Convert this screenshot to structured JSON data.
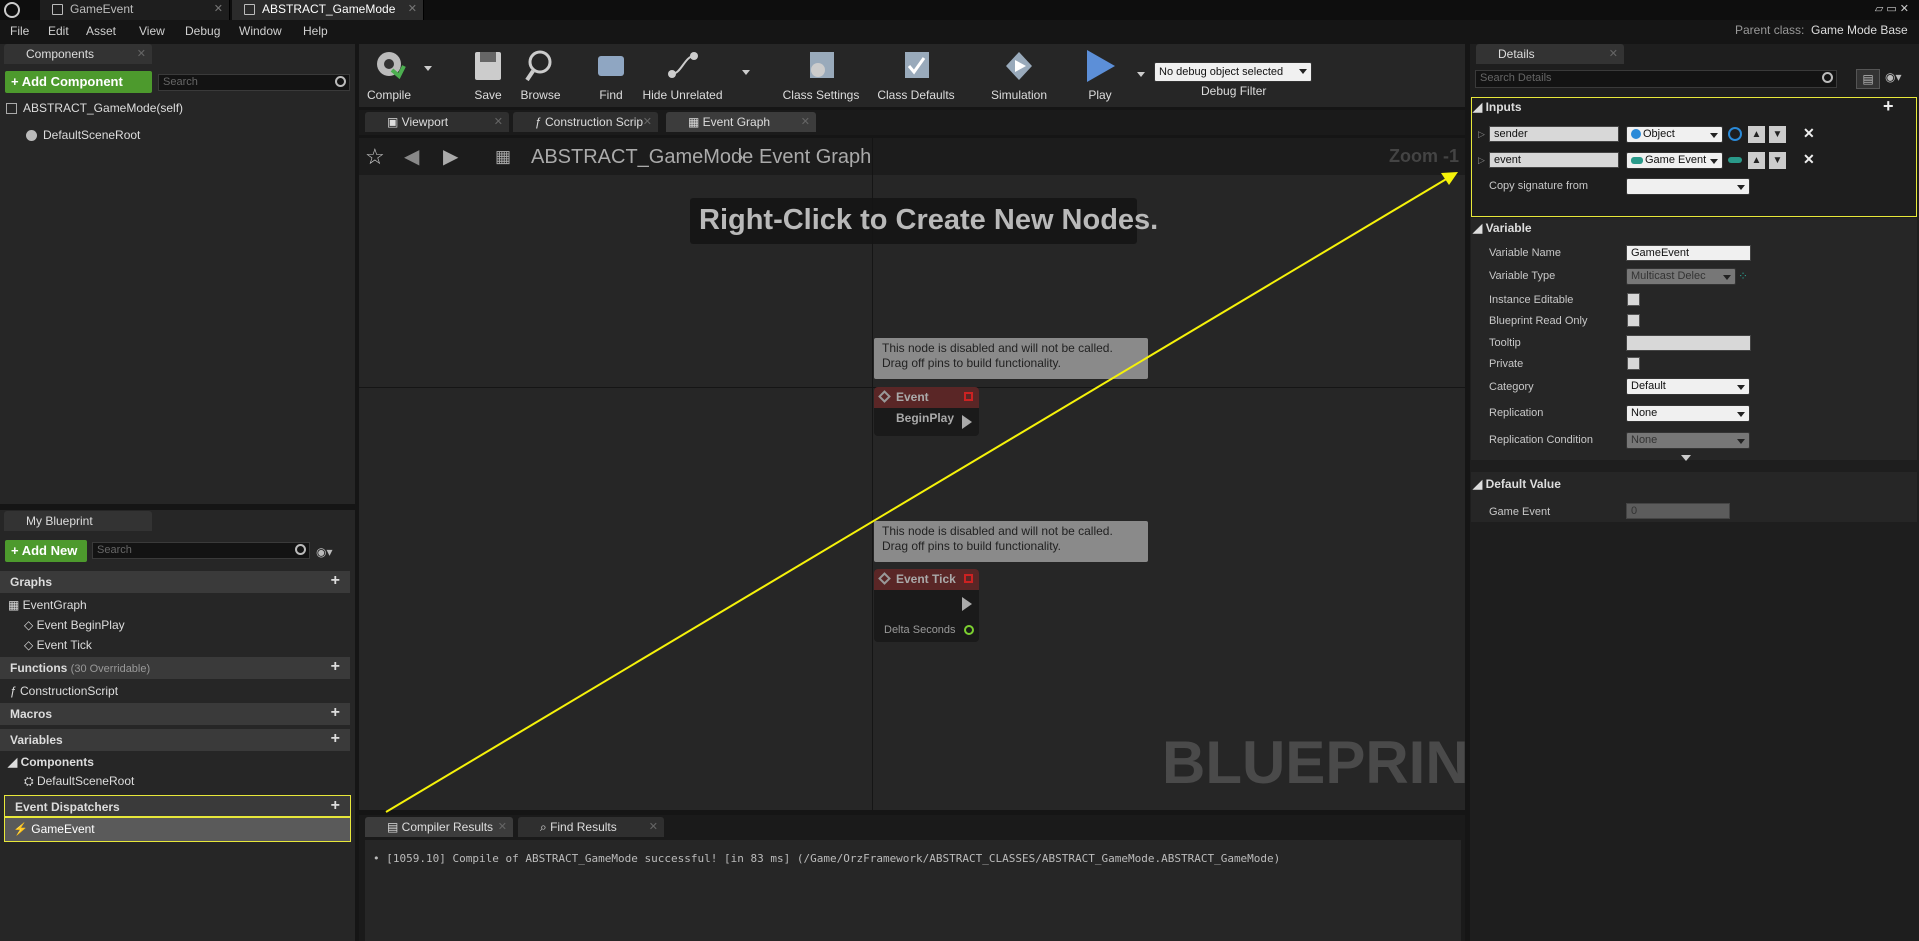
{
  "titlebar": {
    "tabs": [
      "GameEvent",
      "ABSTRACT_GameMode"
    ],
    "parent_class_label": "Parent class:",
    "parent_class_value": "Game Mode Base"
  },
  "menu": [
    "File",
    "Edit",
    "Asset",
    "View",
    "Debug",
    "Window",
    "Help"
  ],
  "components": {
    "tab": "Components",
    "add_label": "+ Add Component",
    "search_placeholder": "Search",
    "self": "ABSTRACT_GameMode(self)",
    "root": "DefaultSceneRoot"
  },
  "toolbar": {
    "compile": "Compile",
    "save": "Save",
    "browse": "Browse",
    "find": "Find",
    "hide_unrelated": "Hide Unrelated",
    "class_settings": "Class Settings",
    "class_defaults": "Class Defaults",
    "simulation": "Simulation",
    "play": "Play",
    "debug_select": "No debug object selected",
    "debug_filter": "Debug Filter"
  },
  "graph_tabs": [
    "Viewport",
    "Construction Scrip",
    "Event Graph"
  ],
  "breadcrumb": {
    "blueprint": "ABSTRACT_GameMode",
    "graph": "Event Graph",
    "zoom": "Zoom -1"
  },
  "graph": {
    "hint": "Right-Click to Create New Nodes.",
    "watermark": "BLUEPRINT",
    "comment_text_1": "This node is disabled and will not be called.",
    "comment_text_2": "Drag off pins to build functionality.",
    "node1": "Event BeginPlay",
    "node2": "Event Tick",
    "delta": "Delta Seconds"
  },
  "my_blueprint": {
    "tab": "My Blueprint",
    "add_label": "+ Add New",
    "search_placeholder": "Search",
    "graphs": "Graphs",
    "event_graph": "EventGraph",
    "begin_play": "Event BeginPlay",
    "tick": "Event Tick",
    "functions": "Functions",
    "functions_count": "(30 Overridable)",
    "construction": "ConstructionScript",
    "macros": "Macros",
    "variables": "Variables",
    "components": "Components",
    "default_root": "DefaultSceneRoot",
    "dispatchers": "Event Dispatchers",
    "game_event": "GameEvent"
  },
  "bottom": {
    "tabs": [
      "Compiler Results",
      "Find Results"
    ],
    "log": "[1059.10] Compile of ABSTRACT_GameMode successful! [in 83 ms] (/Game/OrzFramework/ABSTRACT_CLASSES/ABSTRACT_GameMode.ABSTRACT_GameMode)"
  },
  "details": {
    "tab": "Details",
    "search_placeholder": "Search Details",
    "inputs": "Inputs",
    "in1_name": "sender",
    "in1_type": "Object",
    "in2_name": "event",
    "in2_type": "Game Event",
    "copy_sig": "Copy signature from",
    "variable": "Variable",
    "labels": [
      "Variable Name",
      "Variable Type",
      "Instance Editable",
      "Blueprint Read Only",
      "Tooltip",
      "Private",
      "Category",
      "Replication",
      "Replication Condition"
    ],
    "var_name": "GameEvent",
    "var_type": "Multicast Delec",
    "category": "Default",
    "replication": "None",
    "rep_condition": "None",
    "default_value": "Default Value",
    "default_label": "Game Event",
    "default_val": "0"
  }
}
